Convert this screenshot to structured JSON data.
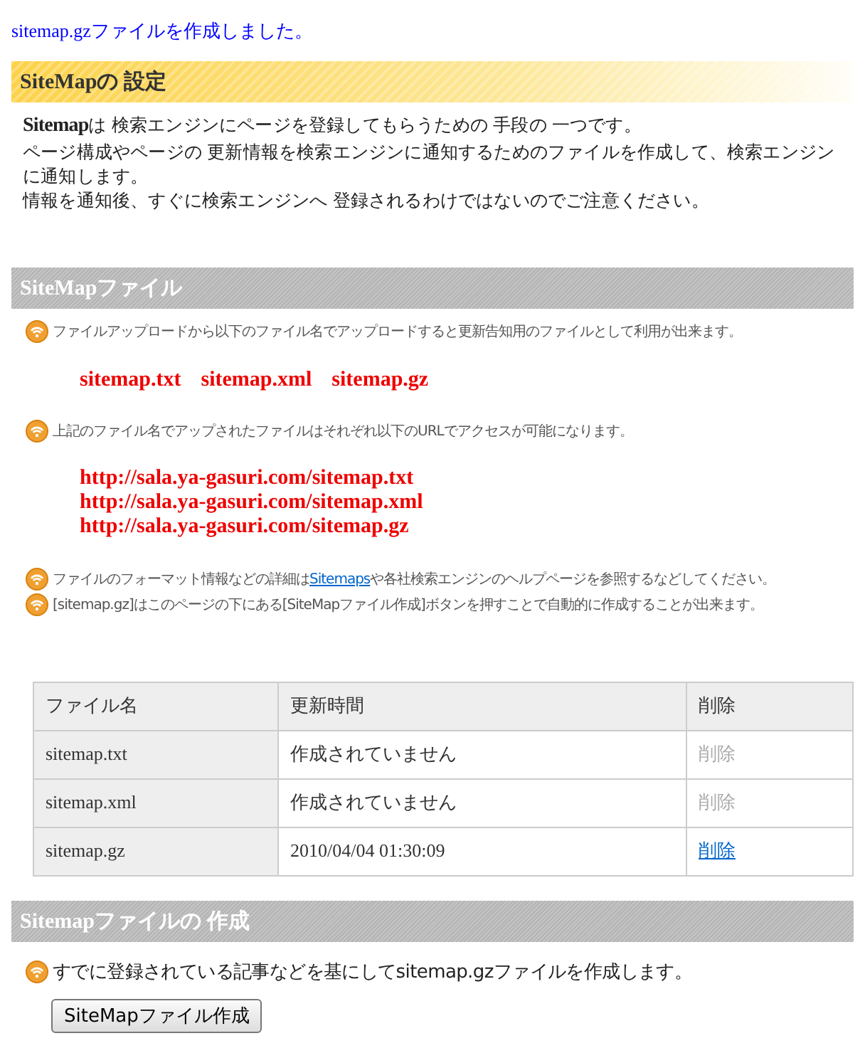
{
  "message": "sitemap.gzファイルを作成しました。",
  "settings": {
    "title": "SiteMapの 設定",
    "kind": "yellow",
    "paragraphs": [
      "**Sitemap**は 検索エンジンにページを登録してもらうための 手段の 一つです。",
      "ページ構成やページの 更新情報を検索エンジンに通知するためのファイルを作成して、検索エンジンに通知します。",
      "情報を通知後、すぐに検索エンジンへ 登録されるわけではないのでご注意ください。"
    ]
  },
  "files_section": {
    "title": "SiteMapファイル",
    "kind": "gray",
    "blocks": [
      {
        "kind": "note",
        "segments": [
          {
            "kind": "text",
            "text": "ファイルアップロードから以下のファイル名でアップロードすると更新告知用のファイルとして利用が出来ます。"
          }
        ]
      },
      {
        "kind": "names",
        "items": [
          "sitemap.txt",
          "sitemap.xml",
          "sitemap.gz"
        ]
      },
      {
        "kind": "note",
        "segments": [
          {
            "kind": "text",
            "text": "上記のファイル名でアップされたファイルはそれぞれ以下のURLでアクセスが可能になります。"
          }
        ]
      },
      {
        "kind": "urls",
        "items": [
          "http://sala.ya-gasuri.com/sitemap.txt",
          "http://sala.ya-gasuri.com/sitemap.xml",
          "http://sala.ya-gasuri.com/sitemap.gz"
        ]
      },
      {
        "kind": "note",
        "segments": [
          {
            "kind": "text",
            "text": "ファイルのフォーマット情報などの詳細は"
          },
          {
            "kind": "link",
            "text": "Sitemaps"
          },
          {
            "kind": "text",
            "text": "や各社検索エンジンのヘルプページを参照するなどしてください。"
          }
        ]
      },
      {
        "kind": "note",
        "segments": [
          {
            "kind": "text",
            "text": "[sitemap.gz]はこのページの下にある[SiteMapファイル作成]ボタンを押すことで自動的に作成することが出来ます。"
          }
        ]
      }
    ]
  },
  "table": {
    "columns": [
      "ファイル名",
      "更新時間",
      "削除"
    ],
    "rows": [
      {
        "file": "sitemap.txt",
        "updated": "作成されていません",
        "delete": "削除",
        "disabled": true
      },
      {
        "file": "sitemap.xml",
        "updated": "作成されていません",
        "delete": "削除",
        "disabled": true
      },
      {
        "file": "sitemap.gz",
        "updated": "2010/04/04 01:30:09",
        "delete": "削除",
        "disabled": false
      }
    ]
  },
  "create_section": {
    "title": "Sitemapファイルの 作成",
    "kind": "gray",
    "note": "すでに登録されている記事などを基にしてsitemap.gzファイルを作成します。",
    "button": "SiteMapファイル作成"
  }
}
